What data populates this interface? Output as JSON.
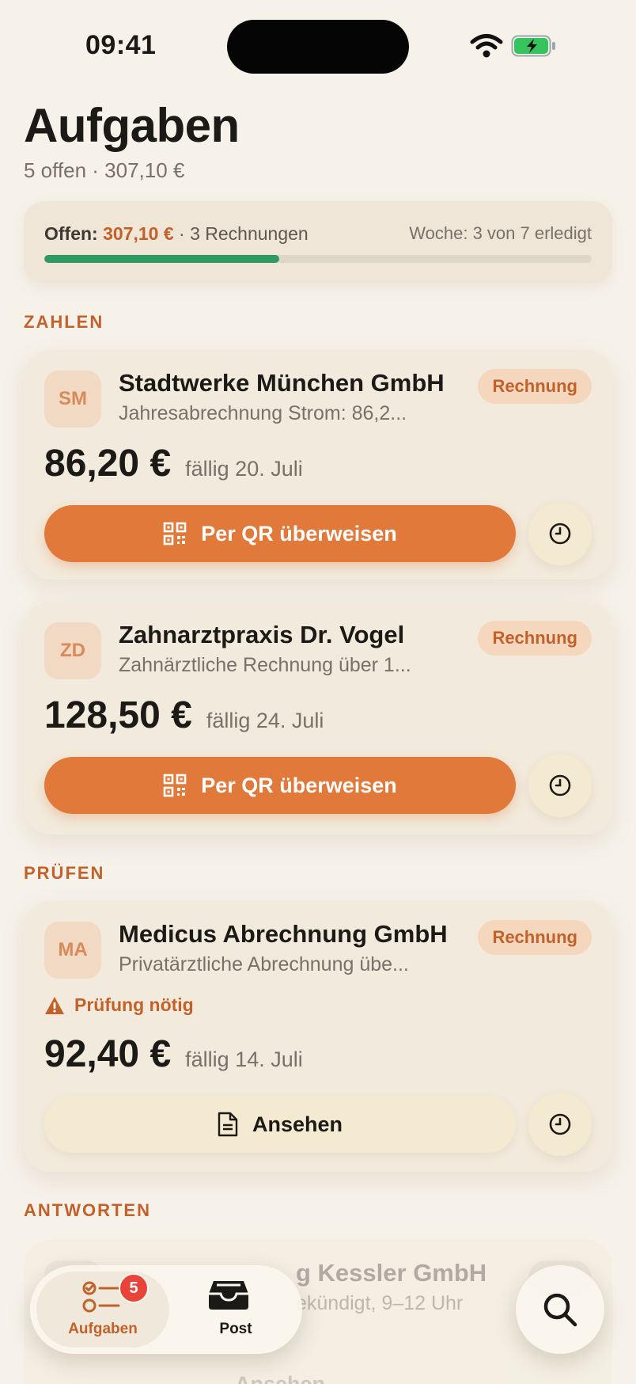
{
  "status": {
    "time": "09:41"
  },
  "header": {
    "title": "Aufgaben",
    "subtitle": "5 offen · 307,10 €"
  },
  "summary": {
    "open_label": "Offen:",
    "open_amount": "307,10 €",
    "invoices": "· 3 Rechnungen",
    "week": "Woche: 3 von 7 erledigt",
    "progress_fraction": 0.4286,
    "progress_color": "#2e9a62"
  },
  "sections": {
    "pay": "ZAHLEN",
    "review": "PRÜFEN",
    "reply": "ANTWORTEN"
  },
  "cards": [
    {
      "initials": "SM",
      "vendor": "Stadtwerke München GmbH",
      "desc": "Jahresabrechnung Strom: 86,2...",
      "badge": "Rechnung",
      "amount": "86,20 €",
      "due": "fällig 20. Juli",
      "action": "Per QR überweisen"
    },
    {
      "initials": "ZD",
      "vendor": "Zahnarztpraxis Dr. Vogel",
      "desc": "Zahnärztliche Rechnung über 1...",
      "badge": "Rechnung",
      "amount": "128,50 €",
      "due": "fällig 24. Juli",
      "action": "Per QR überweisen"
    },
    {
      "initials": "MA",
      "vendor": "Medicus Abrechnung GmbH",
      "desc": "Privatärztliche Abrechnung übe...",
      "badge": "Rechnung",
      "warning": "Prüfung nötig",
      "amount": "92,40 €",
      "due": "fällig 14. Juli",
      "action": "Ansehen"
    }
  ],
  "ghost_card": {
    "vendor": "g Kessler GmbH",
    "desc": "ekündigt, 9–12 Uhr",
    "action": "Ansehen"
  },
  "tabbar": {
    "tasks_label": "Aufgaben",
    "tasks_count": "5",
    "mail_label": "Post"
  },
  "colors": {
    "accent": "#e0793a",
    "accent_text": "#c2612a",
    "badge_red": "#e8443a"
  },
  "icons": {
    "pay": "qr-code-icon",
    "view": "document-icon",
    "snooze": "clock-icon",
    "warning": "warning-icon",
    "tasks": "checklist-icon",
    "mail": "inbox-tray-icon",
    "search": "search-icon"
  }
}
